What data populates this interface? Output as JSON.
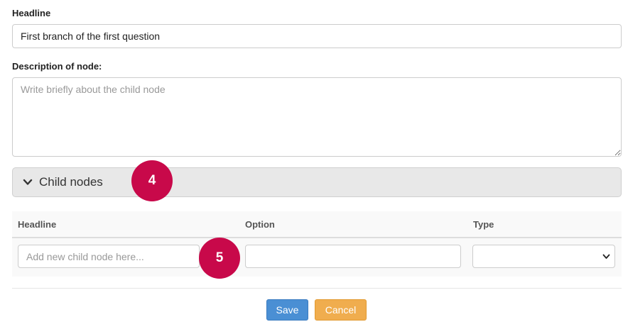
{
  "headline": {
    "label": "Headline",
    "value": "First branch of the first question"
  },
  "description": {
    "label": "Description of node:",
    "placeholder": "Write briefly about the child node",
    "value": ""
  },
  "child_nodes_panel": {
    "title": "Child nodes",
    "chevron_icon": "chevron-down-icon"
  },
  "child_table": {
    "columns": [
      "Headline",
      "Option",
      "Type"
    ],
    "new_row": {
      "headline_placeholder": "Add new child node here...",
      "option_value": "",
      "type_value": ""
    }
  },
  "markers": {
    "panel_marker": "4",
    "row_marker": "5",
    "color": "#c8094a"
  },
  "actions": {
    "save_label": "Save",
    "cancel_label": "Cancel",
    "save_color": "#4a8fd4",
    "cancel_color": "#f0ad4e"
  }
}
